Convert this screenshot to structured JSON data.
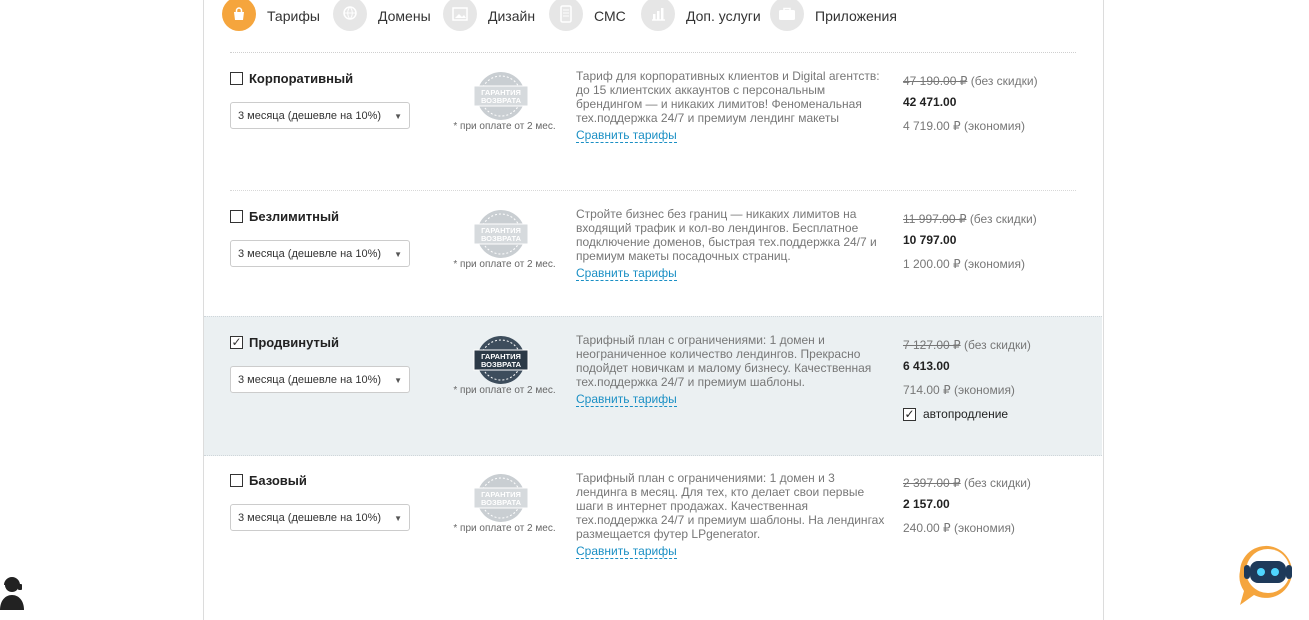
{
  "tabs": [
    {
      "label": "Тарифы",
      "icon": "bag-icon",
      "active": true
    },
    {
      "label": "Домены",
      "icon": "www-globe-icon",
      "active": false
    },
    {
      "label": "Дизайн",
      "icon": "image-icon",
      "active": false
    },
    {
      "label": "СМС",
      "icon": "phone-icon",
      "active": false
    },
    {
      "label": "Доп. услуги",
      "icon": "chart-icon",
      "active": false
    },
    {
      "label": "Приложения",
      "icon": "briefcase-icon",
      "active": false
    }
  ],
  "badge_text_line1": "ГАРАНТИЯ",
  "badge_text_line2": "ВОЗВРАТА",
  "plans": [
    {
      "name": "Корпоративный",
      "checked": false,
      "period": "3 месяца (дешевле на 10%)",
      "badge_note": "* при оплате от 2 мес.",
      "description": "Тариф для корпоративных клиентов и Digital агентств: до 15 клиентских аккаунтов с персональным брендингом — и никаких лимитов! Феноменальная тех.поддержка 24/7 и премиум лендинг макеты",
      "compare": "Сравнить тарифы",
      "old_price": "47 190.00 ₽",
      "old_suffix": "(без скидки)",
      "new_price": "42 471.00",
      "saving": "4 719.00 ₽ (экономия)"
    },
    {
      "name": "Безлимитный",
      "checked": false,
      "period": "3 месяца (дешевле на 10%)",
      "badge_note": "* при оплате от 2 мес.",
      "description": "Стройте бизнес без границ — никаких лимитов на входящий трафик и кол-во лендингов. Бесплатное подключение доменов, быстрая тех.поддержка 24/7 и премиум макеты посадочных страниц.",
      "compare": "Сравнить тарифы",
      "old_price": "11 997.00 ₽",
      "old_suffix": "(без скидки)",
      "new_price": "10 797.00",
      "saving": "1 200.00 ₽ (экономия)"
    },
    {
      "name": "Продвинутый",
      "checked": true,
      "period": "3 месяца (дешевле на 10%)",
      "badge_note": "* при оплате от 2 мес.",
      "description": "Тарифный план с ограничениями: 1 домен и неограниченное количество лендингов. Прекрасно подойдет новичкам и малому бизнесу. Качественная тех.поддержка 24/7 и премиум шаблоны.",
      "compare": "Сравнить тарифы",
      "old_price": "7 127.00 ₽",
      "old_suffix": "(без скидки)",
      "new_price": "6 413.00",
      "saving": "714.00 ₽ (экономия)",
      "auto_renew": "автопродление"
    },
    {
      "name": "Базовый",
      "checked": false,
      "period": "3 месяца (дешевле на 10%)",
      "badge_note": "* при оплате от 2 мес.",
      "description": "Тарифный план с ограничениями: 1 домен и 3 лендинга в месяц. Для тех, кто делает свои первые шаги в интернет продажах. Качественная тех.поддержка 24/7 и премиум шаблоны. На лендингах размещается футер LPgenerator.",
      "compare": "Сравнить тарифы",
      "old_price": "2 397.00 ₽",
      "old_suffix": "(без скидки)",
      "new_price": "2 157.00",
      "saving": "240.00 ₽ (экономия)"
    }
  ],
  "colors": {
    "accent": "#f5a53d",
    "link": "#1a8fc4",
    "selected_row": "#ebf0f2"
  }
}
